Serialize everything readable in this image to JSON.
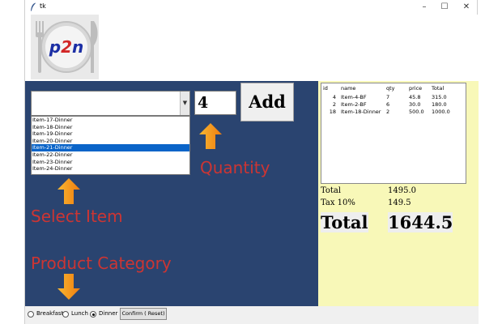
{
  "window": {
    "title": "tk",
    "minimize_glyph": "–",
    "maximize_glyph": "☐",
    "close_glyph": "✕"
  },
  "logo": {
    "text": "p2n",
    "icon": "plate-fork-knife-icon"
  },
  "combo": {
    "value": ""
  },
  "item_list": {
    "items": [
      "Item-17-Dinner",
      "Item-18-Dinner",
      "Item-19-Dinner",
      "Item-20-Dinner",
      "Item-21-Dinner",
      "Item-22-Dinner",
      "Item-23-Dinner",
      "Item-24-Dinner"
    ],
    "selected_index": 4
  },
  "quantity": {
    "value": "4"
  },
  "add_button": {
    "label": "Add"
  },
  "annotations": {
    "quantity": "Quantity",
    "select_item": "Select Item",
    "product_category": "Product Category",
    "arrow_color": "#f5a623"
  },
  "order_table": {
    "columns": [
      "id",
      "name",
      "qty",
      "price",
      "Total"
    ],
    "rows": [
      [
        "4",
        "Item-4-BF",
        "7",
        "45.8",
        "315.0"
      ],
      [
        "2",
        "Item-2-BF",
        "6",
        "30.0",
        "180.0"
      ],
      [
        "18",
        "Item-18-Dinner",
        "2",
        "500.0",
        "1000.0"
      ]
    ]
  },
  "summary": {
    "total_label": "Total",
    "total_value": "1495.0",
    "tax_label": "Tax 10%",
    "tax_value": "149.5",
    "grand_label": "Total",
    "grand_value": "1644.5"
  },
  "categories": {
    "options": [
      "Breakfast",
      "Lunch",
      "Dinner"
    ],
    "selected": "Dinner"
  },
  "confirm_button": {
    "label": "Confirm ( Reset)"
  },
  "colors": {
    "left_panel": "#2a4470",
    "right_panel": "#f8f8b8",
    "annotation_text": "#cc3533",
    "selection": "#0a64c8"
  }
}
